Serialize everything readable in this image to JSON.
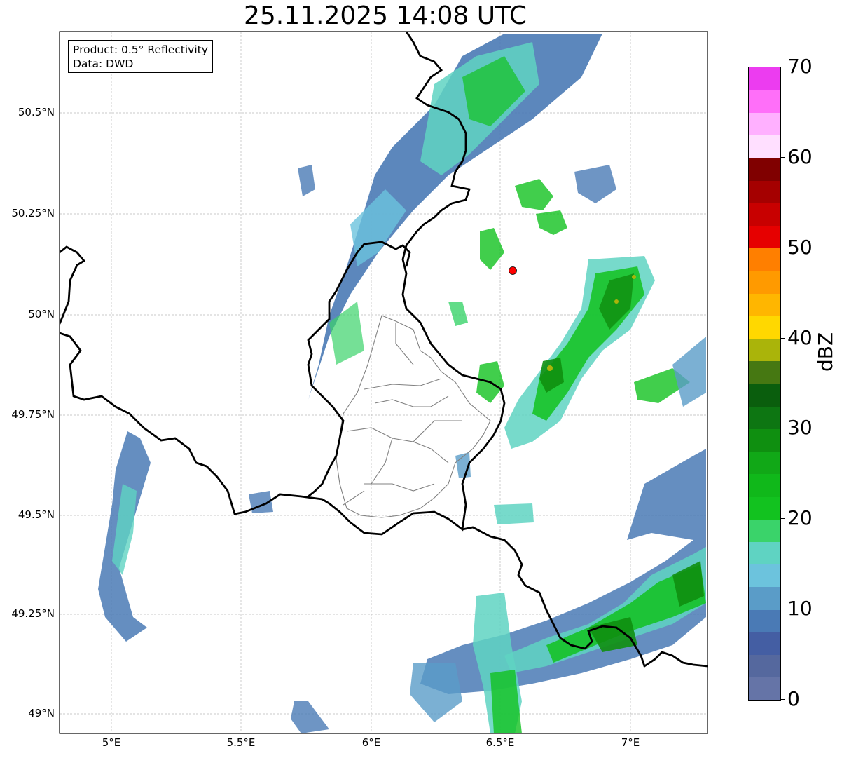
{
  "title": "25.11.2025 14:08 UTC",
  "info_box": {
    "line1": "Product: 0.5° Reflectivity",
    "line2": "Data: DWD"
  },
  "lat_labels": [
    "50.5°N",
    "50.25°N",
    "50°N",
    "49.75°N",
    "49.5°N",
    "49.25°N",
    "49°N"
  ],
  "lon_labels": [
    "5°E",
    "5.5°E",
    "6°E",
    "6.5°E",
    "7°E"
  ],
  "colorbar": {
    "label": "dBZ",
    "tick_labels": [
      "0",
      "10",
      "20",
      "30",
      "40",
      "50",
      "60",
      "70"
    ],
    "colors": [
      "#6574a7",
      "#55689e",
      "#445ea3",
      "#4a7ab5",
      "#5a9cc8",
      "#6cc3dd",
      "#5fd3c2",
      "#3ad36a",
      "#12c21f",
      "#10b81a",
      "#11a817",
      "#0f8f10",
      "#0d7612",
      "#0a5e0d",
      "#467812",
      "#aab40a",
      "#ffd800",
      "#ffb600",
      "#ff9a00",
      "#ff7f00",
      "#e60000",
      "#c80000",
      "#a50000",
      "#800000",
      "#ffdfff",
      "#ffb0ff",
      "#ff6ff9",
      "#ec3cf0"
    ]
  },
  "radar_site": {
    "lon": 6.55,
    "lat": 50.11,
    "color": "#ff0000"
  },
  "extent": {
    "lon_min": 4.8,
    "lon_max": 7.3,
    "lat_min": 48.95,
    "lat_max": 50.7
  }
}
